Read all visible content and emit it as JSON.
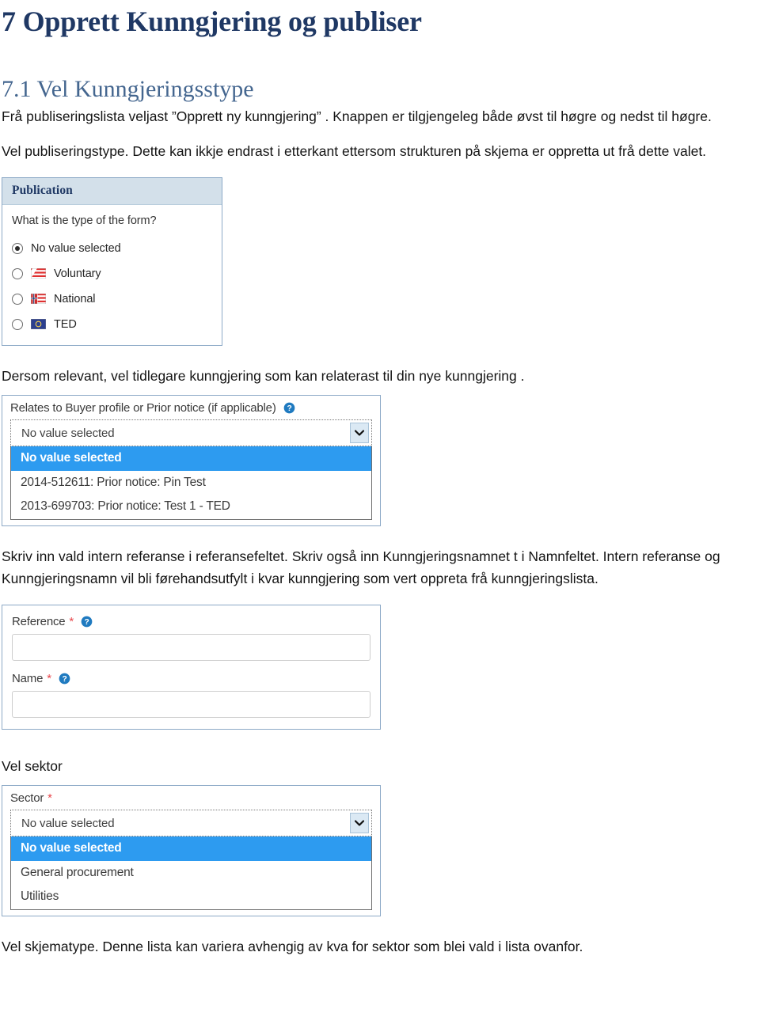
{
  "document": {
    "heading1": "7 Opprett Kunngjering og publiser",
    "heading2": "7.1 Vel Kunngjeringsstype",
    "paragraph1": "Frå publiseringslista veljast ”Opprett ny kunngjering” . Knappen er tilgjengeleg både øvst til høgre og nedst til høgre.",
    "paragraph2": "Vel publiseringstype. Dette kan ikkje endrast i etterkant ettersom strukturen på skjema er oppretta ut  frå dette valet.",
    "paragraph3": "Dersom relevant, vel tidlegare kunngjering som kan relaterast til din nye kunngjering .",
    "paragraph4": "Skriv inn vald intern referanse i referansefeltet. Skriv også inn Kunngjeringsnamnet t i Namnfeltet. Intern referanse og Kunngjeringsnamn vil  bli førehandsutfylt  i kvar kunngjering som vert oppreta frå kunngjeringslista.",
    "paragraph5": "Vel sektor",
    "paragraph6": "Vel  skjematype. Denne lista kan variera avhengig av kva for sektor som blei vald i lista ovanfor."
  },
  "colors": {
    "heading1": "#1f3864",
    "heading2": "#44668f",
    "panel_header_bg": "#d3e0ea",
    "panel_border": "#8ca9c6",
    "selected_option_bg": "#2d9bf0",
    "required_star": "#e8474c",
    "help_icon": "#1f7ac0",
    "dropdown_button_bg": "#dbe9f4"
  },
  "publication_panel": {
    "title": "Publication",
    "question": "What is the type of the form?",
    "options": [
      {
        "label": "No value selected",
        "checked": true,
        "flag": "none"
      },
      {
        "label": "Voluntary",
        "checked": false,
        "flag": "voluntary-flag-icon"
      },
      {
        "label": "National",
        "checked": false,
        "flag": "norway-flag-icon"
      },
      {
        "label": "TED",
        "checked": false,
        "flag": "eu-flag-icon"
      }
    ]
  },
  "prior_notice_panel": {
    "label": "Relates to Buyer profile or Prior notice (if applicable)",
    "help_icon": "help-icon",
    "selected_value": "No value selected",
    "options": [
      {
        "label": "No value selected",
        "selected": true
      },
      {
        "label": "2014-512611: Prior notice: Pin Test",
        "selected": false
      },
      {
        "label": "2013-699703: Prior notice: Test 1 - TED",
        "selected": false
      }
    ]
  },
  "reference_panel": {
    "fields": [
      {
        "label": "Reference",
        "required_marker": "*",
        "help_icon": "help-icon",
        "value": "",
        "placeholder": ""
      },
      {
        "label": "Name",
        "required_marker": "*",
        "help_icon": "help-icon",
        "value": "",
        "placeholder": ""
      }
    ]
  },
  "sector_panel": {
    "label": "Sector",
    "required_marker": "*",
    "selected_value": "No value selected",
    "options": [
      {
        "label": "No value selected",
        "selected": true
      },
      {
        "label": "General procurement",
        "selected": false
      },
      {
        "label": "Utilities",
        "selected": false
      }
    ]
  }
}
